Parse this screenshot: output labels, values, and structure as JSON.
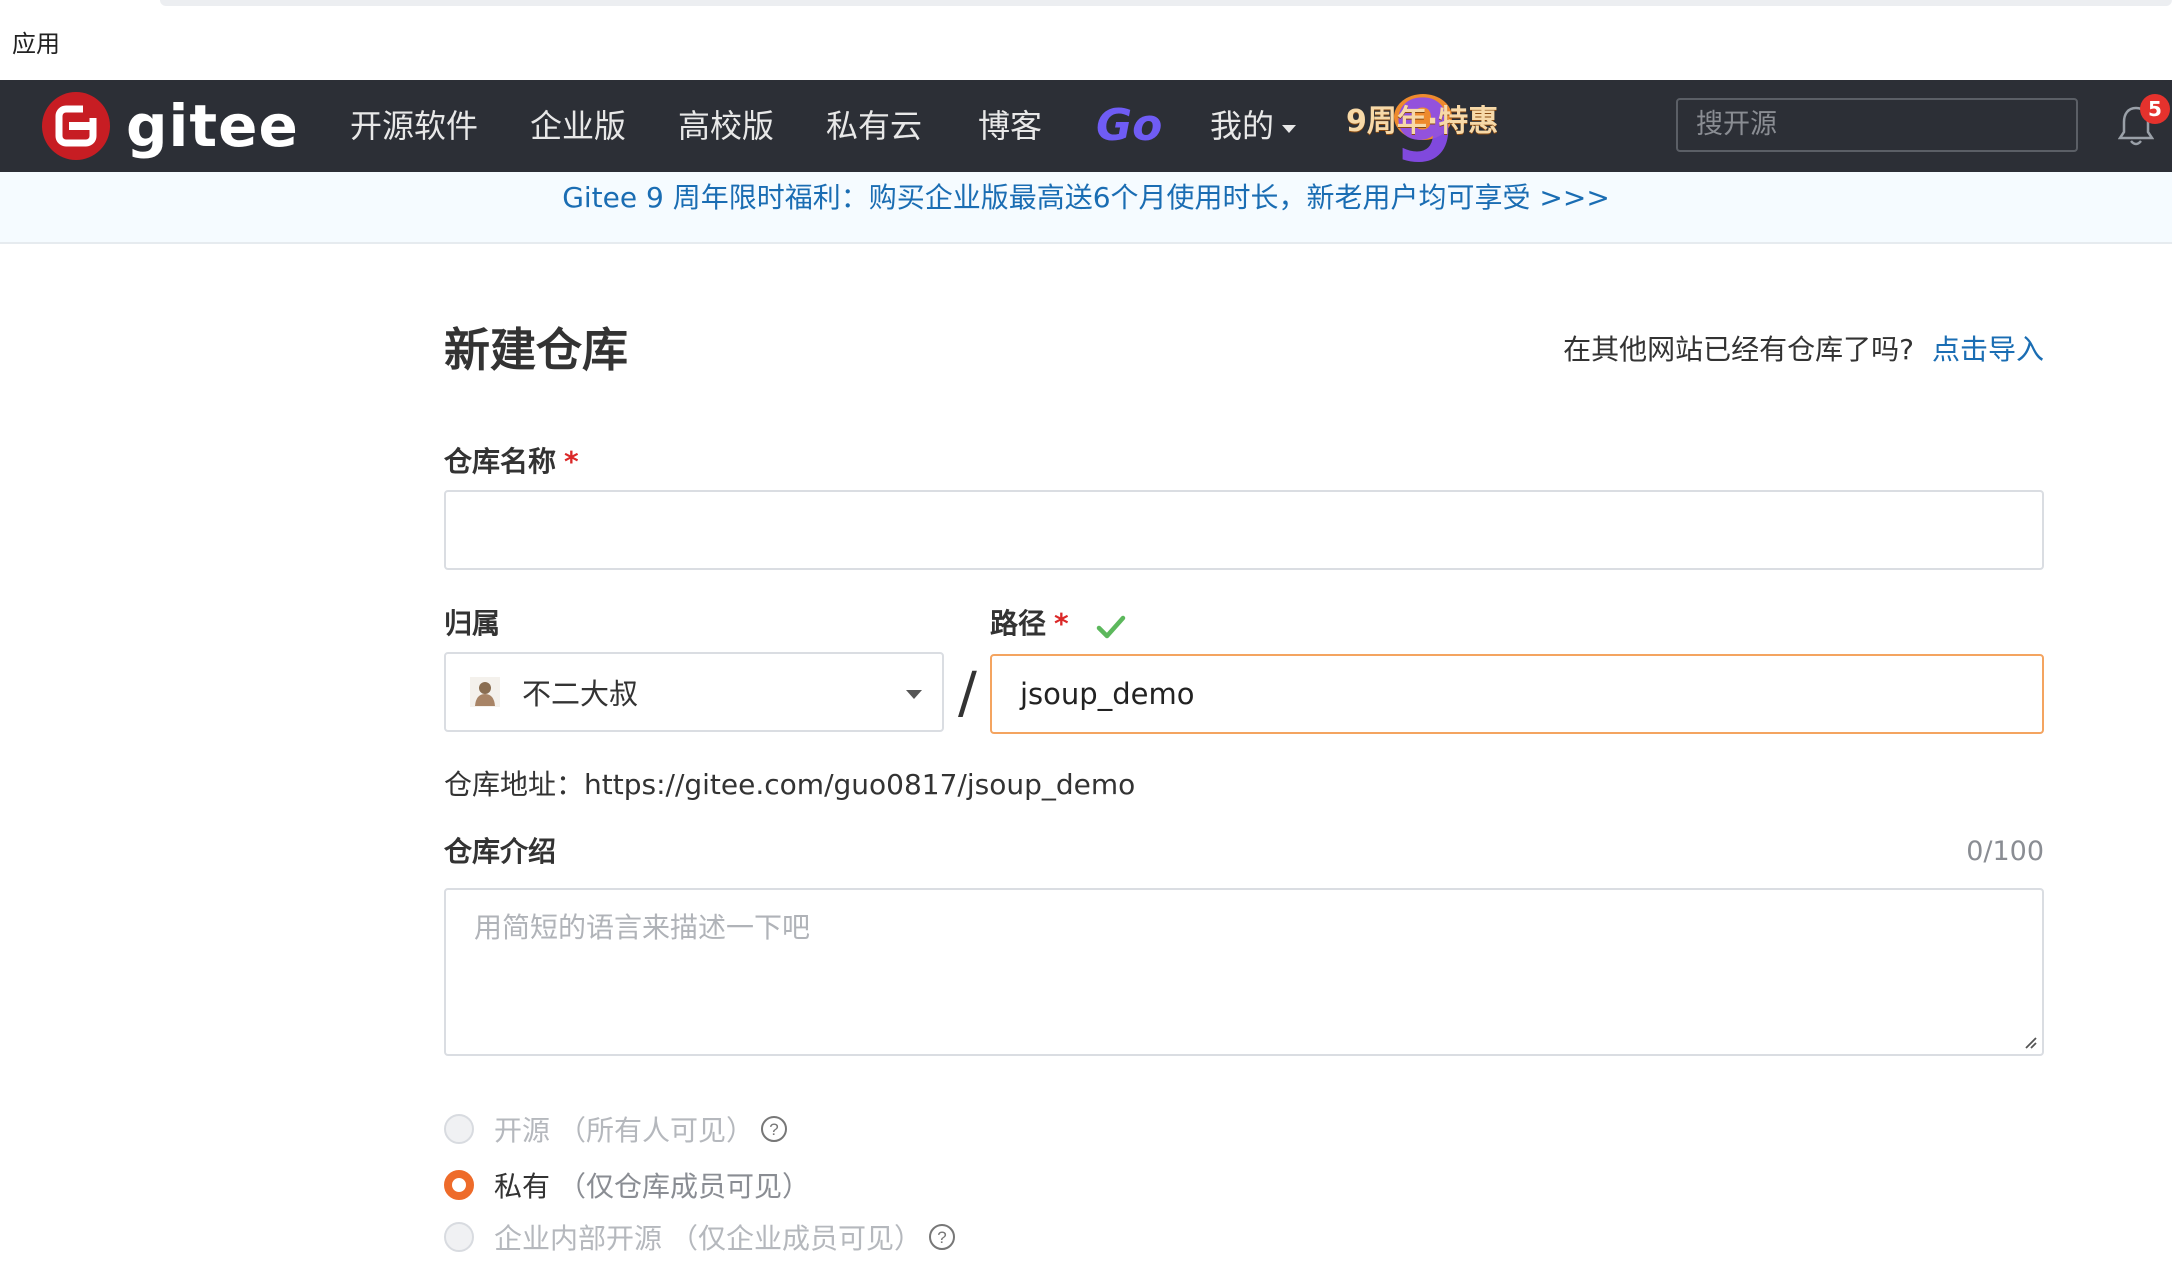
{
  "browser": {
    "apps_label": "应用"
  },
  "navbar": {
    "logo_text": "gitee",
    "items": [
      "开源软件",
      "企业版",
      "高校版",
      "私有云",
      "博客"
    ],
    "go_label": "Go",
    "mine_label": "我的",
    "anniversary_label": "9周年·特惠",
    "search_placeholder": "搜开源",
    "notification_count": "5"
  },
  "banner": {
    "text": "Gitee 9 周年限时福利：购买企业版最高送6个月使用时长，新老用户均可享受 >>>"
  },
  "form": {
    "title": "新建仓库",
    "import_question": "在其他网站已经有仓库了吗?",
    "import_link": "点击导入",
    "name_label": "仓库名称",
    "required_mark": "*",
    "name_value": "",
    "owner_label": "归属",
    "owner_value": "不二大叔",
    "path_label": "路径",
    "path_value": "jsoup_demo",
    "address_prefix": "仓库地址：",
    "address_value": "https://gitee.com/guo0817/jsoup_demo",
    "desc_label": "仓库介绍",
    "desc_counter": "0/100",
    "desc_placeholder": "用简短的语言来描述一下吧",
    "visibility": [
      {
        "label": "开源",
        "hint": "（所有人可见）",
        "checked": false,
        "help": true
      },
      {
        "label": "私有",
        "hint": "（仅仓库成员可见）",
        "checked": true,
        "help": false
      },
      {
        "label": "企业内部开源",
        "hint": "（仅企业成员可见）",
        "checked": false,
        "help": true
      }
    ]
  },
  "colors": {
    "navbar_bg": "#2c2f36",
    "brand_red": "#c71d23",
    "link_blue": "#1a6db3",
    "radio_accent": "#ee6b2a",
    "path_focus": "#f4a460",
    "check_green": "#5cb85c"
  }
}
